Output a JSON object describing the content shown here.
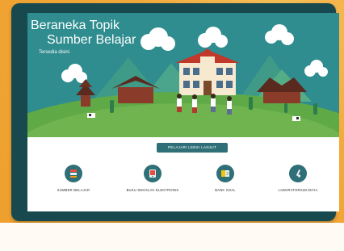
{
  "hero": {
    "title_line1": "Beraneka Topik",
    "title_line2": "Sumber Belajar",
    "subtitle": "Tersedia disini"
  },
  "cta": {
    "label": "PELAJARI LEBIH LANJUT"
  },
  "nav": {
    "items": [
      {
        "label": "SUMBER BELAJAR",
        "icon": "books-icon"
      },
      {
        "label": "BUKU SEKOLAH ELEKTRONIK",
        "icon": "ebook-icon"
      },
      {
        "label": "BANK SOAL",
        "icon": "question-bank-icon"
      },
      {
        "label": "LABORATORIUM MAYA",
        "icon": "lab-pipette-icon"
      }
    ]
  },
  "colors": {
    "frame": "#17494f",
    "accent": "#2f6f78",
    "sky": "#2f8c8f",
    "hill": "#6fb44e",
    "orange_bg": "#f2a93b"
  }
}
